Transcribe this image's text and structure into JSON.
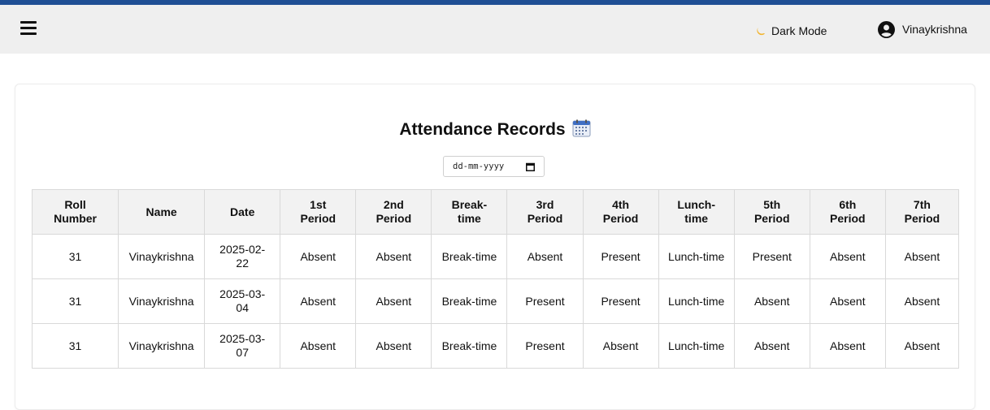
{
  "header": {
    "dark_mode_label": "Dark Mode",
    "user_name": "Vinaykrishna"
  },
  "page": {
    "title": "Attendance Records",
    "title_icon": "calendar-icon",
    "date_placeholder": "dd-mm-yyyy"
  },
  "table": {
    "columns": [
      [
        "Roll",
        "Number"
      ],
      [
        "Name"
      ],
      [
        "Date"
      ],
      [
        "1st",
        "Period"
      ],
      [
        "2nd",
        "Period"
      ],
      [
        "Break-",
        "time"
      ],
      [
        "3rd",
        "Period"
      ],
      [
        "4th",
        "Period"
      ],
      [
        "Lunch-",
        "time"
      ],
      [
        "5th",
        "Period"
      ],
      [
        "6th",
        "Period"
      ],
      [
        "7th",
        "Period"
      ]
    ],
    "rows": [
      [
        "31",
        "Vinaykrishna",
        [
          "2025-02-",
          "22"
        ],
        "Absent",
        "Absent",
        "Break-time",
        "Absent",
        "Present",
        "Lunch-time",
        "Present",
        "Absent",
        "Absent"
      ],
      [
        "31",
        "Vinaykrishna",
        [
          "2025-03-",
          "04"
        ],
        "Absent",
        "Absent",
        "Break-time",
        "Present",
        "Present",
        "Lunch-time",
        "Absent",
        "Absent",
        "Absent"
      ],
      [
        "31",
        "Vinaykrishna",
        [
          "2025-03-",
          "07"
        ],
        "Absent",
        "Absent",
        "Break-time",
        "Present",
        "Absent",
        "Lunch-time",
        "Absent",
        "Absent",
        "Absent"
      ]
    ]
  },
  "colors": {
    "accent": "#1f4f94",
    "navbar_bg": "#efefef",
    "header_bg": "#f2f2f2",
    "border": "#d9d9d9"
  }
}
